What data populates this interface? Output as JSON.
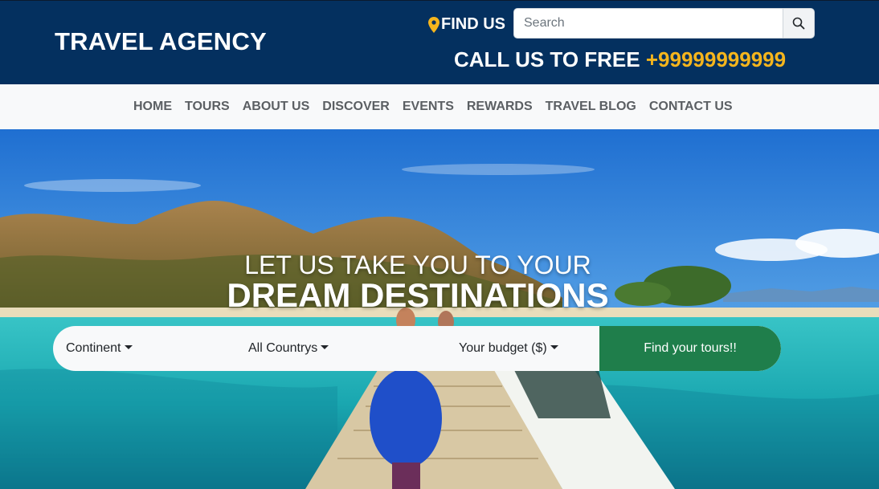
{
  "header": {
    "brand": "TRAVEL AGENCY",
    "find_us": "FIND US",
    "search_placeholder": "Search",
    "call_label": "CALL US TO FREE",
    "phone": "+99999999999",
    "colors": {
      "bg": "#04305f",
      "accent": "#f5b51d"
    }
  },
  "nav": {
    "items": [
      {
        "label": "HOME"
      },
      {
        "label": "TOURS"
      },
      {
        "label": "ABOUT US"
      },
      {
        "label": "DISCOVER"
      },
      {
        "label": "EVENTS"
      },
      {
        "label": "REWARDS"
      },
      {
        "label": "TRAVEL BLOG"
      },
      {
        "label": "CONTACT US"
      }
    ]
  },
  "hero": {
    "line1": "LET US TAKE YOU TO YOUR",
    "line2": "DREAM DESTINATIONS",
    "filters": {
      "continent": "Continent",
      "country": "All Countrys",
      "budget": "Your budget ($)"
    },
    "cta": "Find your tours!!",
    "cta_color": "#1f7e4b"
  },
  "icons": {
    "pin": "map-pin-icon",
    "search": "search-icon"
  }
}
